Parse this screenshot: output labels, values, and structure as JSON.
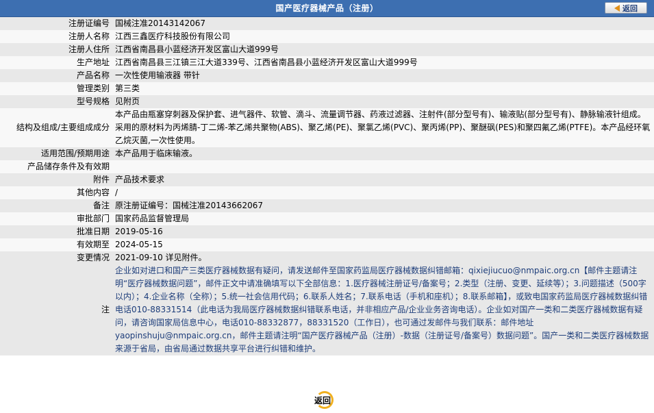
{
  "header": {
    "title": "国产医疗器械产品（注册）",
    "back_label": "返回"
  },
  "rows": [
    {
      "label": "注册证编号",
      "value": "国械注准20143142067"
    },
    {
      "label": "注册人名称",
      "value": "江西三鑫医疗科技股份有限公司"
    },
    {
      "label": "注册人住所",
      "value": "江西省南昌县小蓝经济开发区富山大道999号"
    },
    {
      "label": "生产地址",
      "value": "江西省南昌县三江镇三江大道339号、江西省南昌县小蓝经济开发区富山大道999号"
    },
    {
      "label": "产品名称",
      "value": "一次性使用输液器 带针"
    },
    {
      "label": "管理类别",
      "value": "第三类"
    },
    {
      "label": "型号规格",
      "value": "见附页"
    },
    {
      "label": "结构及组成/主要组成成分",
      "value": "本产品由瓶塞穿刺器及保护套、进气器件、软管、滴斗、流量调节器、药液过滤器、注射件(部分型号有)、输液贴(部分型号有)、静脉输液针组成。采用的原材料为丙烯腈-丁二烯-苯乙烯共聚物(ABS)、聚乙烯(PE)、聚氯乙烯(PVC)、聚丙烯(PP)、聚醚砜(PES)和聚四氟乙烯(PTFE)。本产品经环氧乙烷灭菌,一次性使用。"
    },
    {
      "label": "适用范围/预期用途",
      "value": "本产品用于临床输液。"
    },
    {
      "label": "产品储存条件及有效期",
      "value": ""
    },
    {
      "label": "附件",
      "value": "产品技术要求"
    },
    {
      "label": "其他内容",
      "value": "/"
    },
    {
      "label": "备注",
      "value": "原注册证编号：国械注准20143662067"
    },
    {
      "label": "审批部门",
      "value": "国家药品监督管理局"
    },
    {
      "label": "批准日期",
      "value": "2019-05-16"
    },
    {
      "label": "有效期至",
      "value": "2024-05-15"
    },
    {
      "label": "变更情况",
      "value": "2021-09-10 详见附件。"
    }
  ],
  "note": {
    "label": "注",
    "text": "企业如对进口和国产三类医疗器械数据有疑问，请发送邮件至国家药监局医疗器械数据纠错邮箱：qixiejiucuo@nmpaic.org.cn【邮件主题请注明“医疗器械数据问题”，邮件正文中请准确填写以下全部信息：1.医疗器械注册证号/备案号；2.类型（注册、变更、延续等）；3.问题描述（500字以内）；4.企业名称（全称）；5.统一社会信用代码；6.联系人姓名；7.联系电话（手机和座机）；8.联系邮箱】，或致电国家药监局医疗器械数据纠错电话010-88331514（此电话为我局医疗器械数据纠错联系电话，并非相应产品/企业业务咨询电话）。企业如对国产一类和二类医疗器械数据有疑问，请咨询国家局信息中心，电话010-88332877，88331520（工作日），也可通过发邮件与我们联系：邮件地址yaopinshuju@nmpaic.org.cn，邮件主题请注明“国产医疗器械产品（注册）-数据（注册证号/备案号）数据问题”。国产一类和二类医疗器械数据来源于省局，由省局通过数据共享平台进行纠错和维护。"
  },
  "footer": {
    "back_label": "返回"
  }
}
